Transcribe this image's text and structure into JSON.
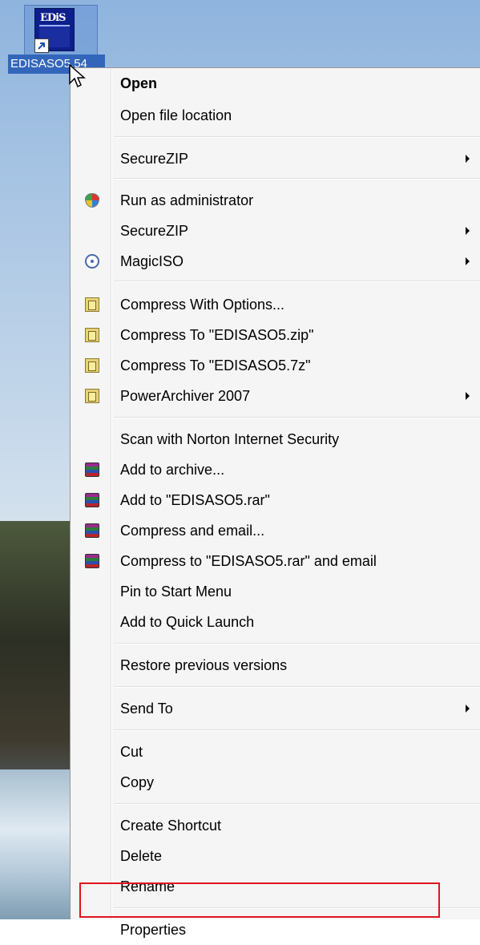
{
  "desktop": {
    "icon_label": "EDISASO5.54",
    "icon_image_text": "EDiS"
  },
  "context_menu": {
    "items": [
      {
        "label": "Open",
        "bold": true,
        "submenu": false,
        "icon": null
      },
      {
        "label": "Open file location",
        "submenu": false,
        "icon": null
      },
      {
        "label": "SecureZIP",
        "submenu": true,
        "icon": null
      },
      {
        "label": "Run as administrator",
        "submenu": false,
        "icon": "uac-shield-icon"
      },
      {
        "label": "SecureZIP",
        "submenu": true,
        "icon": null
      },
      {
        "label": "MagicISO",
        "submenu": true,
        "icon": "magiciso-icon"
      },
      {
        "label": "Compress With Options...",
        "submenu": false,
        "icon": "powerarchiver-icon"
      },
      {
        "label": "Compress To \"EDISASO5.zip\"",
        "submenu": false,
        "icon": "powerarchiver-icon"
      },
      {
        "label": "Compress To \"EDISASO5.7z\"",
        "submenu": false,
        "icon": "powerarchiver-icon"
      },
      {
        "label": "PowerArchiver 2007",
        "submenu": true,
        "icon": "powerarchiver-icon"
      },
      {
        "label": "Scan with Norton Internet Security",
        "submenu": false,
        "icon": null
      },
      {
        "label": "Add to archive...",
        "submenu": false,
        "icon": "winrar-icon"
      },
      {
        "label": "Add to \"EDISASO5.rar\"",
        "submenu": false,
        "icon": "winrar-icon"
      },
      {
        "label": "Compress and email...",
        "submenu": false,
        "icon": "winrar-icon"
      },
      {
        "label": "Compress to \"EDISASO5.rar\" and email",
        "submenu": false,
        "icon": "winrar-icon"
      },
      {
        "label": "Pin to Start Menu",
        "submenu": false,
        "icon": null
      },
      {
        "label": "Add to Quick Launch",
        "submenu": false,
        "icon": null
      },
      {
        "label": "Restore previous versions",
        "submenu": false,
        "icon": null
      },
      {
        "label": "Send To",
        "submenu": true,
        "icon": null
      },
      {
        "label": "Cut",
        "submenu": false,
        "icon": null
      },
      {
        "label": "Copy",
        "submenu": false,
        "icon": null
      },
      {
        "label": "Create Shortcut",
        "submenu": false,
        "icon": null
      },
      {
        "label": "Delete",
        "submenu": false,
        "icon": null
      },
      {
        "label": "Rename",
        "submenu": false,
        "icon": null
      },
      {
        "label": "Properties",
        "submenu": false,
        "icon": null,
        "highlighted": true
      }
    ]
  },
  "colors": {
    "highlight_box": "#e0141e",
    "menu_background": "#f5f5f5",
    "icon_selection": "#3366bb"
  }
}
